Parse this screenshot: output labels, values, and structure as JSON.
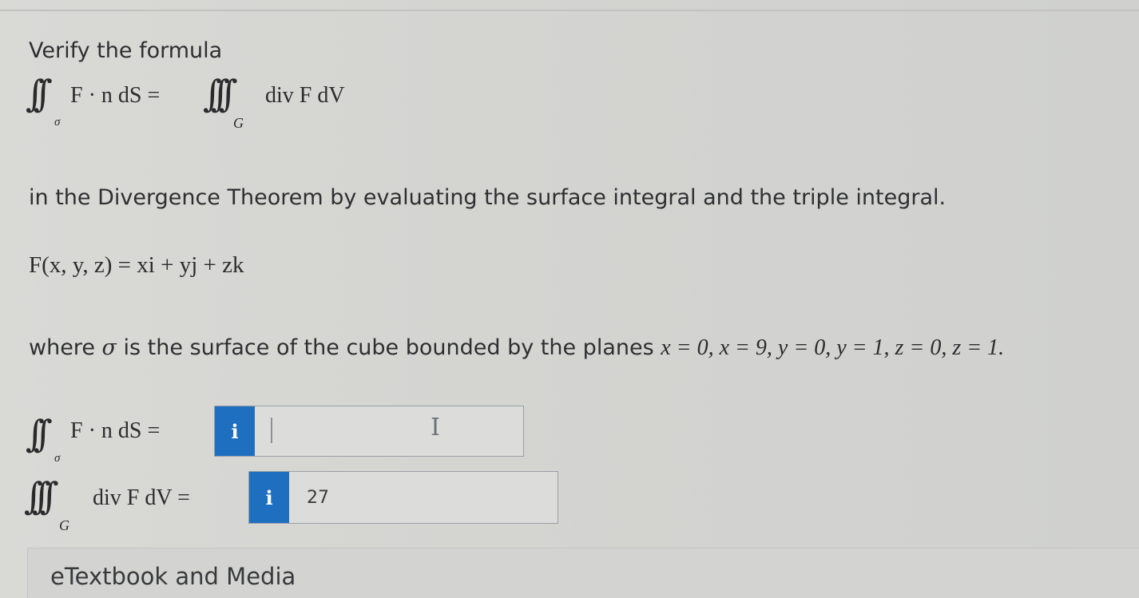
{
  "question": {
    "prompt": "Verify the formula",
    "formula": {
      "left_sub": "σ",
      "left_integrand": "F · n dS =",
      "right_sub": "G",
      "right_integrand": "div F dV"
    },
    "instruction": "in the Divergence Theorem by evaluating the surface integral and the triple integral.",
    "field_def": {
      "lhs": "F(x, y, z) = ",
      "rhs": "xi + yj + zk"
    },
    "surface_desc_prefix": "where ",
    "surface_sigma": "σ",
    "surface_desc_text": " is the surface of the cube bounded by the planes ",
    "surface_planes": "x = 0, x = 9, y = 0, y = 1, z = 0, z = 1."
  },
  "answers": {
    "surface": {
      "label_sub": "σ",
      "label_integrand": "F · n dS =",
      "info_icon": "i",
      "value": ""
    },
    "volume": {
      "label_sub": "G",
      "label_integrand": "div F dV =",
      "info_icon": "i",
      "value": "27"
    }
  },
  "footer": {
    "media_label": "eTextbook and Media"
  },
  "colors": {
    "info_button": "#1f6fc1",
    "background": "#d6d6d4"
  }
}
